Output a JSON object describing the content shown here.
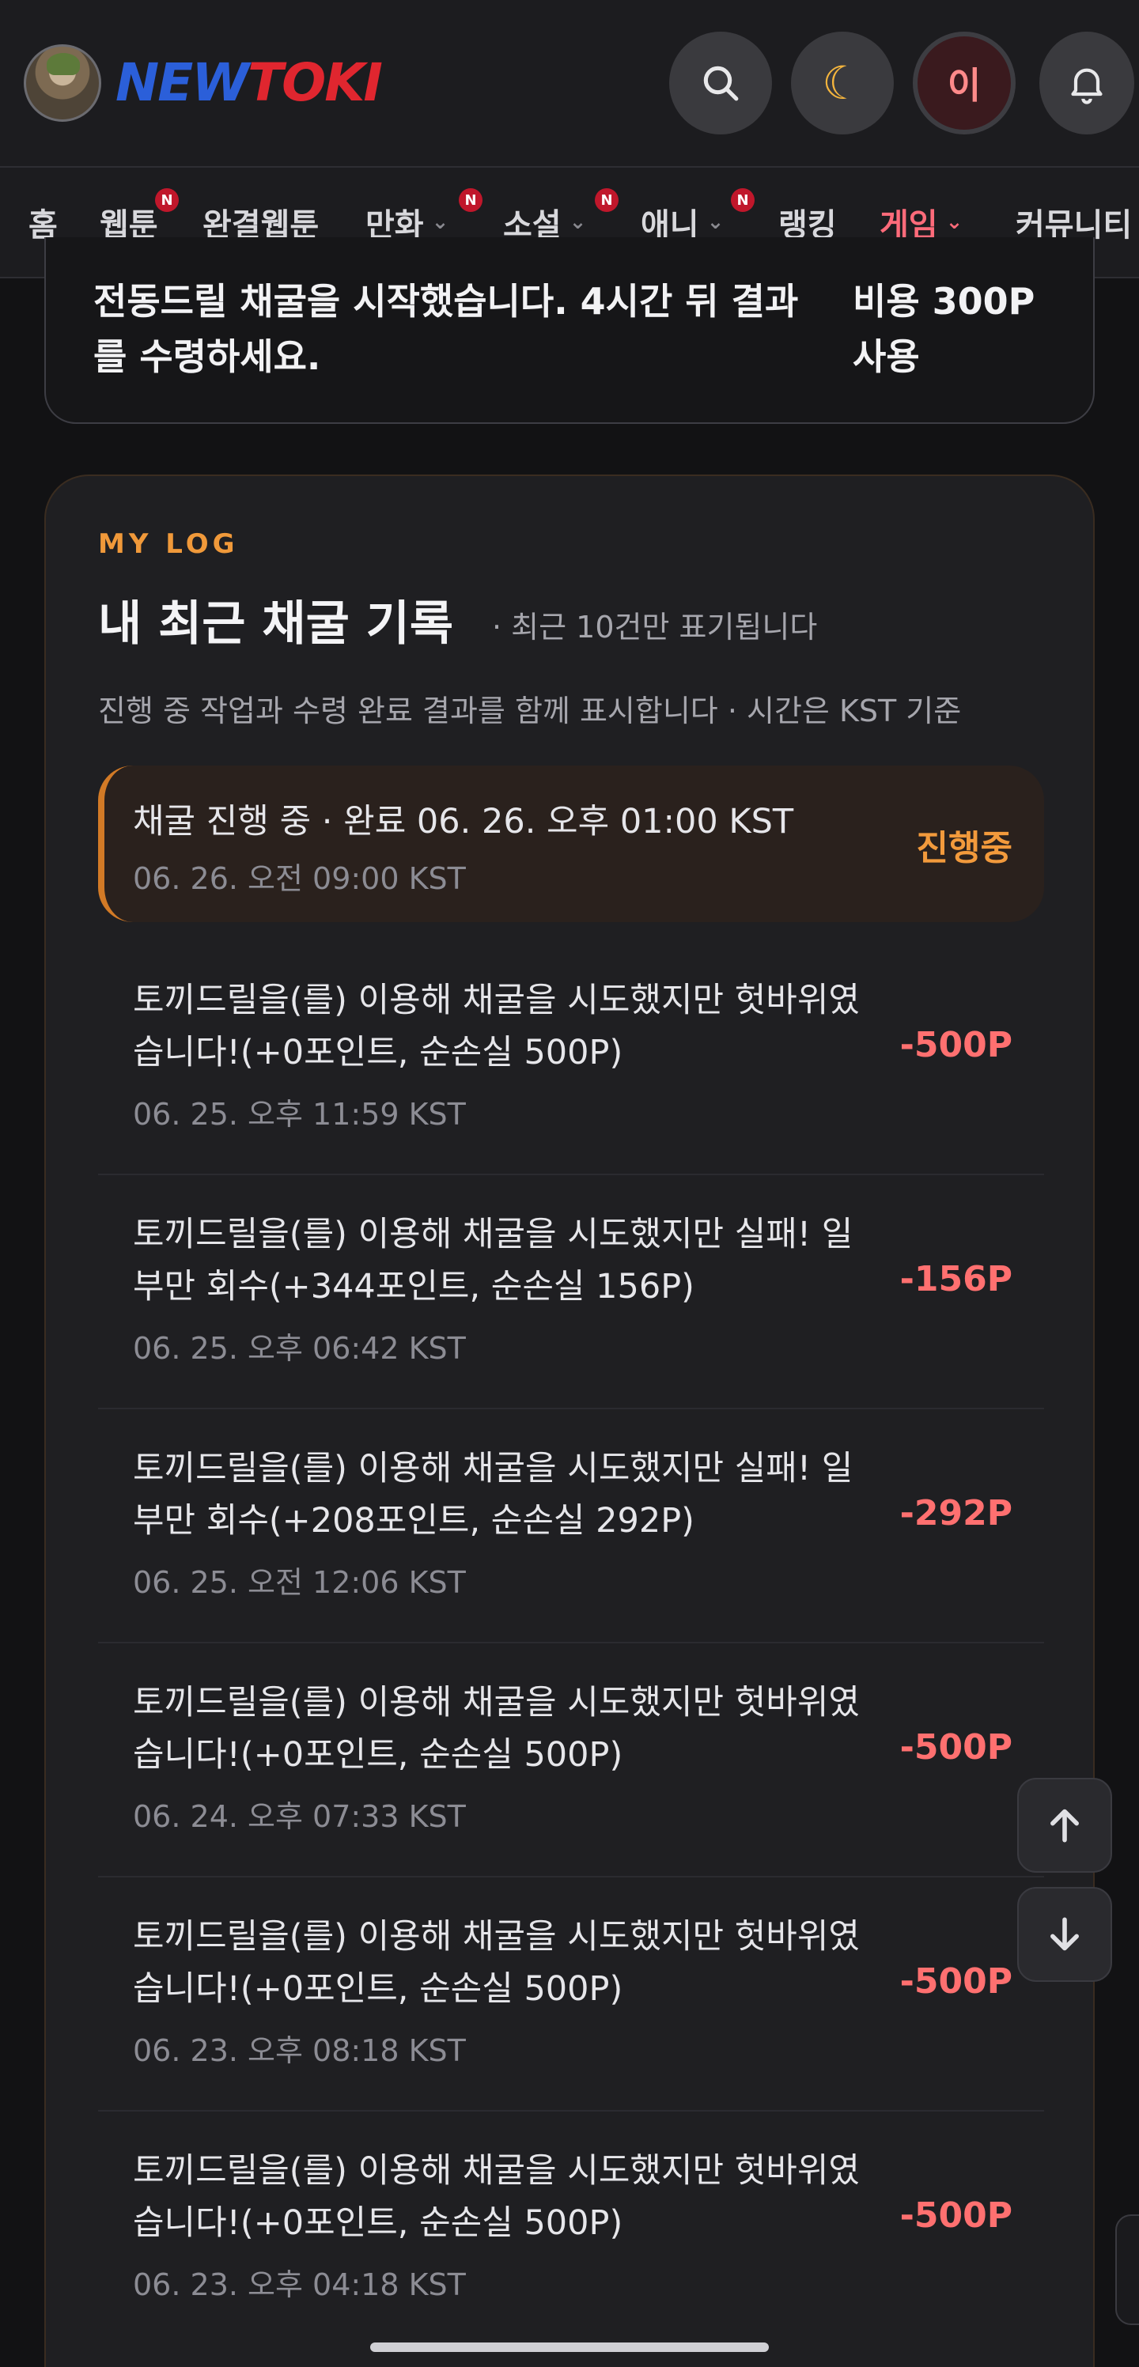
{
  "header": {
    "brand_new": "NEW",
    "brand_toki": "TOKI",
    "user_initial": "이",
    "icons": [
      "search-icon",
      "moon-icon",
      "bell-icon"
    ]
  },
  "nav": {
    "items": [
      {
        "label": "홈",
        "badge": ""
      },
      {
        "label": "웹툰",
        "badge": "N"
      },
      {
        "label": "완결웹툰",
        "badge": ""
      },
      {
        "label": "만화",
        "badge": "N"
      },
      {
        "label": "소설",
        "badge": "N"
      },
      {
        "label": "애니",
        "badge": "N"
      },
      {
        "label": "랭킹",
        "badge": ""
      },
      {
        "label": "게임",
        "badge": ""
      },
      {
        "label": "커뮤니티",
        "badge": ""
      }
    ],
    "active": "게임"
  },
  "top_card": {
    "message": "전동드릴 채굴을 시작했습니다. 4시간 뒤 결과를 수령하세요.",
    "cost": "비용 300P 사용"
  },
  "log": {
    "eyebrow": "MY LOG",
    "title": "내 최근 채굴 기록",
    "note": "· 최근 10건만 표기됩니다",
    "description": "진행 중 작업과 수령 완료 결과를 함께 표시합니다 · 시간은 KST 기준",
    "entries": [
      {
        "text": "채굴 진행 중 · 완료 06. 26. 오후 01:00 KST",
        "time": "06. 26. 오전 09:00 KST",
        "amount": "진행중"
      },
      {
        "text": "토끼드릴을(를) 이용해 채굴을 시도했지만 헛바위였습니다!(+0포인트, 순손실 500P)",
        "time": "06. 25. 오후 11:59 KST",
        "amount": "-500P"
      },
      {
        "text": "토끼드릴을(를) 이용해 채굴을 시도했지만 실패! 일부만 회수(+344포인트, 순손실 156P)",
        "time": "06. 25. 오후 06:42 KST",
        "amount": "-156P"
      },
      {
        "text": "토끼드릴을(를) 이용해 채굴을 시도했지만 실패! 일부만 회수(+208포인트, 순손실 292P)",
        "time": "06. 25. 오전 12:06 KST",
        "amount": "-292P"
      },
      {
        "text": "토끼드릴을(를) 이용해 채굴을 시도했지만 헛바위였습니다!(+0포인트, 순손실 500P)",
        "time": "06. 24. 오후 07:33 KST",
        "amount": "-500P"
      },
      {
        "text": "토끼드릴을(를) 이용해 채굴을 시도했지만 헛바위였습니다!(+0포인트, 순손실 500P)",
        "time": "06. 23. 오후 08:18 KST",
        "amount": "-500P"
      },
      {
        "text": "토끼드릴을(를) 이용해 채굴을 시도했지만 헛바위였습니다!(+0포인트, 순손실 500P)",
        "time": "06. 23. 오후 04:18 KST",
        "amount": "-500P"
      }
    ]
  },
  "colors": {
    "accent_orange": "#f0993a",
    "loss_red": "#ff7070",
    "active_nav": "#ff6b7a"
  }
}
